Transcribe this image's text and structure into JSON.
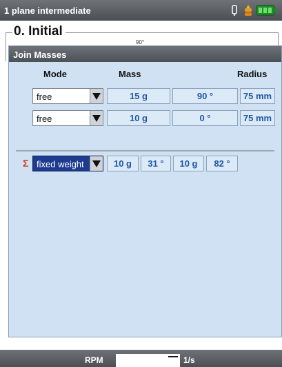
{
  "titlebar": {
    "title": "1 plane intermediate",
    "icons": [
      "probe-icon",
      "drops-icon",
      "battery-icon"
    ],
    "battery_color": "#2fae3a"
  },
  "section": {
    "title": "0. Initial",
    "compass_label": "90°"
  },
  "dialog": {
    "title": "Join Masses",
    "columns": {
      "mode": "Mode",
      "mass": "Mass",
      "radius": "Radius"
    },
    "rows": [
      {
        "mode": "free",
        "mass": "15 g",
        "angle": "90 °",
        "radius": "75 mm"
      },
      {
        "mode": "free",
        "mass": "10 g",
        "angle": "0 °",
        "radius": "75 mm"
      }
    ],
    "result": {
      "symbol": "Σ",
      "mode": "fixed weight",
      "mass1": "10 g",
      "angle1": "31 °",
      "mass2": "10 g",
      "angle2": "82 °"
    }
  },
  "footer": {
    "rpm_label": "RPM",
    "rpm_value": "",
    "unit": "1/s"
  },
  "colors": {
    "dialog_bg": "#cfe1f2",
    "value_text": "#1f58a6",
    "focus": "#1d3b8f",
    "sigma": "#d43a1f"
  }
}
